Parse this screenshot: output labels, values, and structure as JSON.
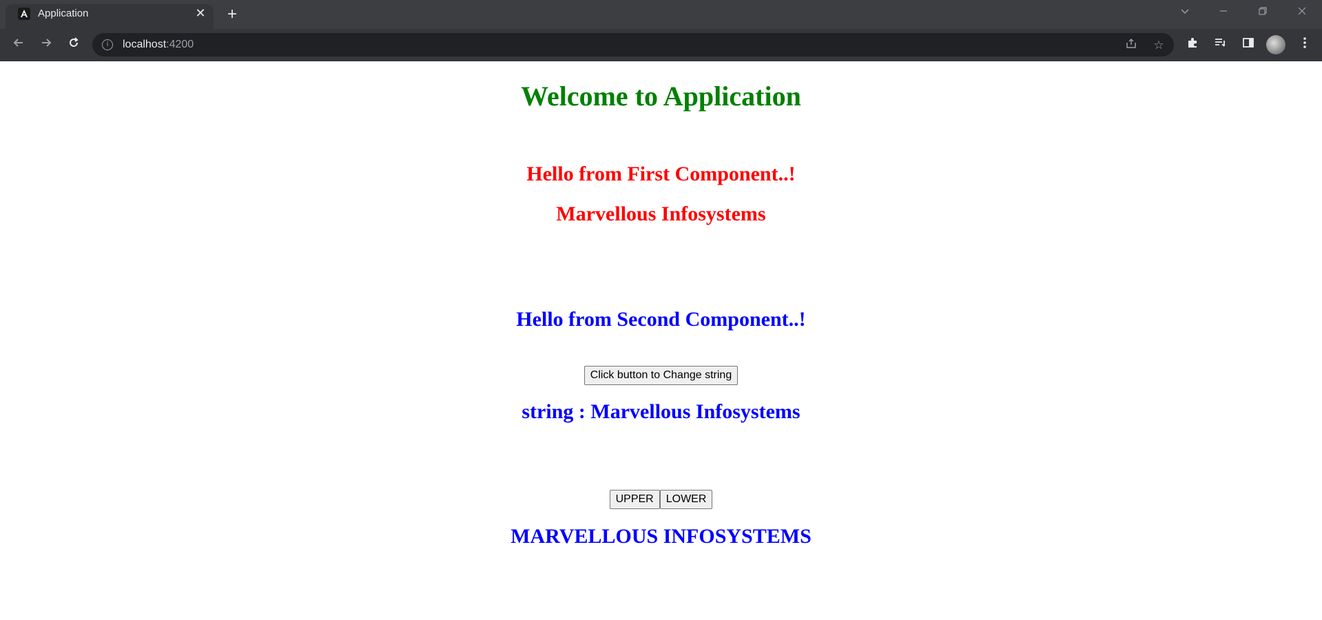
{
  "browser": {
    "tab_title": "Application",
    "url_host": "localhost",
    "url_port": ":4200"
  },
  "page": {
    "heading": "Welcome to Application",
    "first_component": {
      "greeting": "Hello from First Component..!",
      "company": "Marvellous Infosystems"
    },
    "second_component": {
      "greeting": "Hello from Second Component..!",
      "change_button_label": "Click button to Change string",
      "string_display": "string : Marvellous Infosystems",
      "upper_button_label": "UPPER",
      "lower_button_label": "LOWER",
      "case_result": "MARVELLOUS INFOSYSTEMS"
    }
  },
  "colors": {
    "heading": "#008000",
    "first_component": "#ff0000",
    "second_component": "#0000ff"
  }
}
